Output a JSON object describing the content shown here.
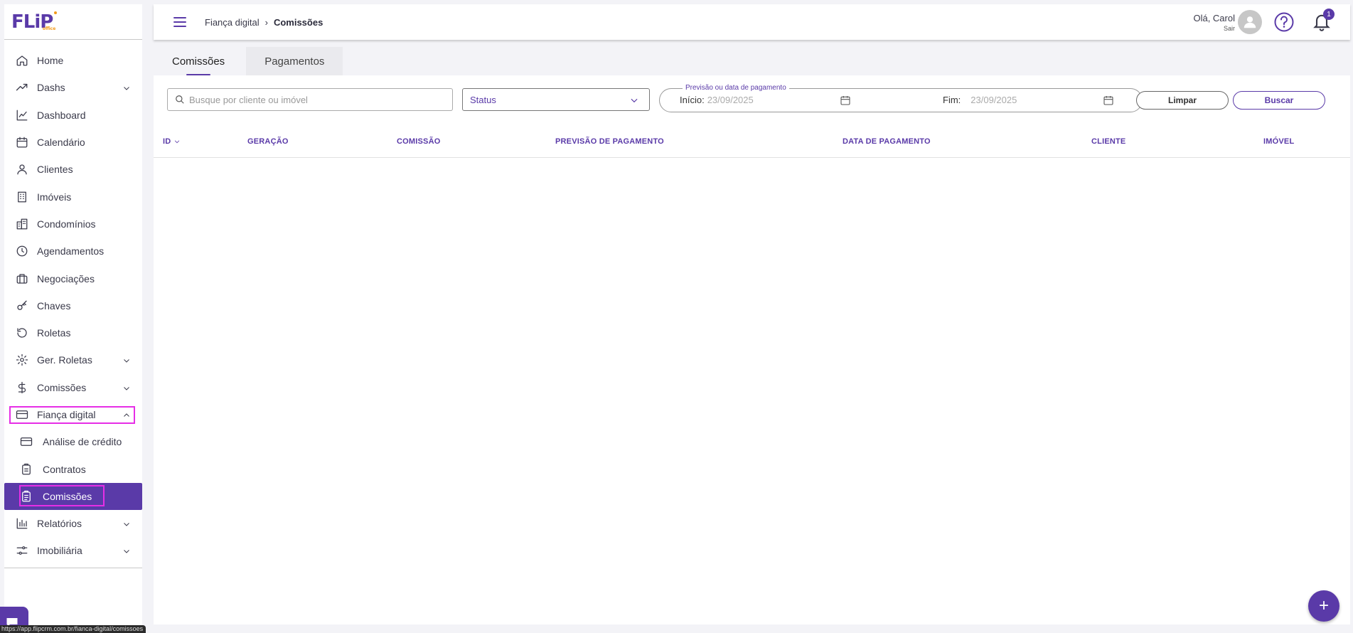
{
  "colors": {
    "primary": "#5a3aa8",
    "highlight": "#e62ee6",
    "accent": "#f29a1a"
  },
  "logo": {
    "text": "FLiP",
    "sub": "office"
  },
  "sidebar": {
    "items": [
      {
        "label": "Home",
        "icon": "home-icon"
      },
      {
        "label": "Dashs",
        "icon": "trending-up-icon",
        "expandable": true
      },
      {
        "label": "Dashboard",
        "icon": "line-chart-icon"
      },
      {
        "label": "Calendário",
        "icon": "calendar-icon"
      },
      {
        "label": "Clientes",
        "icon": "user-icon"
      },
      {
        "label": "Imóveis",
        "icon": "building-icon"
      },
      {
        "label": "Condomínios",
        "icon": "buildings-icon"
      },
      {
        "label": "Agendamentos",
        "icon": "clock-icon"
      },
      {
        "label": "Negociações",
        "icon": "briefcase-icon"
      },
      {
        "label": "Chaves",
        "icon": "key-icon"
      },
      {
        "label": "Roletas",
        "icon": "rotate-icon"
      },
      {
        "label": "Ger. Roletas",
        "icon": "gear-icon",
        "expandable": true
      },
      {
        "label": "Comissões",
        "icon": "dollar-icon",
        "expandable": true
      },
      {
        "label": "Fiança digital",
        "icon": "credit-card-icon",
        "expanded": true
      },
      {
        "label": "Análise de crédito",
        "icon": "credit-card-icon",
        "sub": true
      },
      {
        "label": "Contratos",
        "icon": "clipboard-icon",
        "sub": true
      },
      {
        "label": "Comissões",
        "icon": "clipboard-list-icon",
        "sub": true,
        "active": true
      },
      {
        "label": "Relatórios",
        "icon": "bar-chart-icon",
        "expandable": true
      },
      {
        "label": "Imobiliária",
        "icon": "sliders-icon",
        "expandable": true
      }
    ]
  },
  "header": {
    "breadcrumb": {
      "parent": "Fiança digital",
      "separator": "›",
      "current": "Comissões"
    },
    "greeting": "Olá, Carol",
    "logout": "Sair",
    "notification_count": "1"
  },
  "tabs": [
    {
      "label": "Comissões",
      "active": true
    },
    {
      "label": "Pagamentos",
      "active": false
    }
  ],
  "filters": {
    "search_placeholder": "Busque por cliente ou imóvel",
    "status_label": "Status",
    "date_legend": "Previsão ou data de pagamento",
    "start_label": "Início:",
    "start_value": "23/09/2025",
    "end_label": "Fim:",
    "end_value": "23/09/2025",
    "clear_label": "Limpar",
    "search_label": "Buscar"
  },
  "table": {
    "columns": [
      "ID",
      "GERAÇÃO",
      "COMISSÃO",
      "PREVISÃO DE PAGAMENTO",
      "DATA DE PAGAMENTO",
      "CLIENTE",
      "IMÓVEL"
    ],
    "rows": []
  },
  "fab_label": "+",
  "status_url": "https://app.flipcrm.com.br/fianca-digital/comissoes"
}
